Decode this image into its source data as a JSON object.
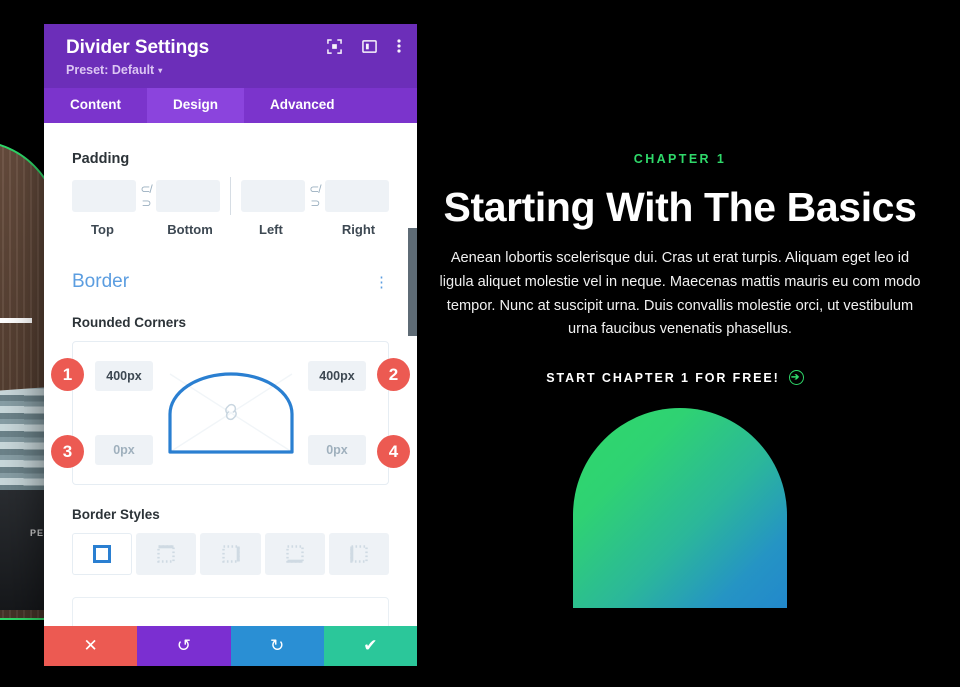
{
  "modal": {
    "title": "Divider Settings",
    "preset": "Preset: Default",
    "preset_caret": "▾",
    "header_icons": [
      {
        "name": "expand-icon",
        "label": "Expand"
      },
      {
        "name": "layout-icon",
        "label": "Layout"
      },
      {
        "name": "more-options-icon",
        "label": "More options"
      }
    ],
    "tabs": [
      {
        "label": "Content",
        "active": false
      },
      {
        "label": "Design",
        "active": true
      },
      {
        "label": "Advanced",
        "active": false
      }
    ],
    "padding": {
      "title": "Padding",
      "link_glyph": "⊂/⊃",
      "fields": [
        {
          "label": "Top",
          "value": "",
          "placeholder": ""
        },
        {
          "label": "Bottom",
          "value": "",
          "placeholder": ""
        },
        {
          "label": "Left",
          "value": "",
          "placeholder": ""
        },
        {
          "label": "Right",
          "value": "",
          "placeholder": ""
        }
      ]
    },
    "border": {
      "section_title": "Border",
      "section_menu": "⋮",
      "rounded_corners_label": "Rounded Corners",
      "corners": [
        {
          "badge": "1",
          "position": "top-left",
          "value": "400px",
          "empty": false
        },
        {
          "badge": "2",
          "position": "top-right",
          "value": "400px",
          "empty": false
        },
        {
          "badge": "3",
          "position": "bottom-left",
          "value": "0px",
          "empty": true
        },
        {
          "badge": "4",
          "position": "bottom-right",
          "value": "0px",
          "empty": true
        }
      ],
      "border_styles_label": "Border Styles",
      "styles": [
        {
          "name": "border-all",
          "active": true
        },
        {
          "name": "border-top",
          "active": false
        },
        {
          "name": "border-right",
          "active": false
        },
        {
          "name": "border-bottom",
          "active": false
        },
        {
          "name": "border-left",
          "active": false
        }
      ]
    },
    "actions": [
      {
        "name": "cancel-button",
        "icon": "✕",
        "color": "#ec5a52"
      },
      {
        "name": "undo-button",
        "icon": "↺",
        "color": "#7b2fd1"
      },
      {
        "name": "redo-button",
        "icon": "↻",
        "color": "#2a8fd4"
      },
      {
        "name": "save-button",
        "icon": "✔",
        "color": "#2bc79a"
      }
    ]
  },
  "preview": {
    "eyebrow": "CHAPTER 1",
    "headline": "Starting With The Basics",
    "body": "Aenean lobortis scelerisque dui. Cras ut erat turpis. Aliquam eget leo id ligula aliquet molestie vel in neque. Maecenas mattis mauris eu com modo tempor. Nunc at suscipit urna. Duis convallis molestie orci, ut vestibulum urna faucibus venenatis phasellus.",
    "cta_label": "START CHAPTER 1 FOR FREE!",
    "cta_arrow": "➔",
    "camera_brand": "PENT",
    "colors": {
      "accent_green": "#2fd96a",
      "gradient_start": "#2fd96a",
      "gradient_end": "#2288cc",
      "background": "#000000"
    }
  }
}
